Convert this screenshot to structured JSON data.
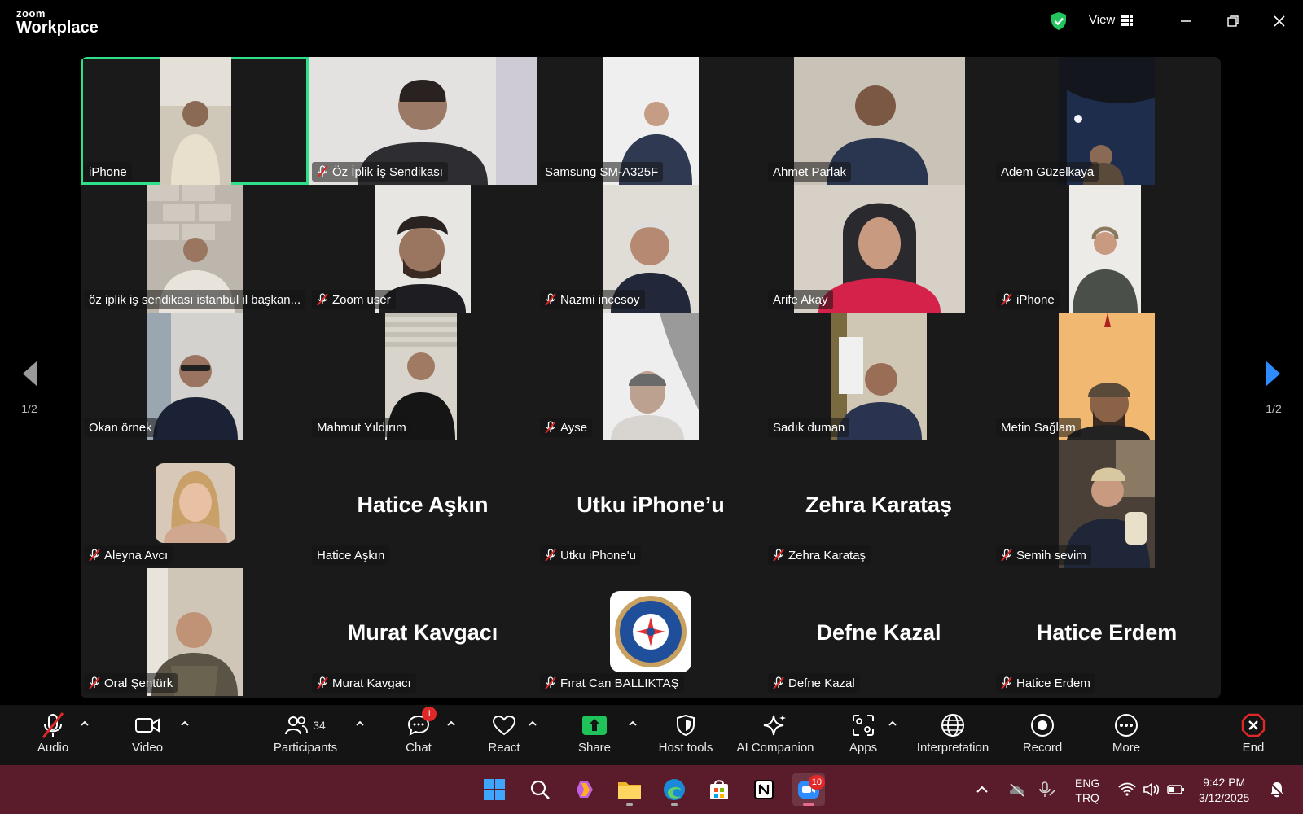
{
  "app": {
    "brand_small": "zoom",
    "brand_large": "Workplace",
    "view_label": "View"
  },
  "pager": {
    "left": "1/2",
    "right": "1/2"
  },
  "participants": [
    {
      "name": "iPhone",
      "muted": false
    },
    {
      "name": "Öz İplik İş Sendikası",
      "muted": true
    },
    {
      "name": "Samsung SM-A325F",
      "muted": false
    },
    {
      "name": "Ahmet Parlak",
      "muted": false
    },
    {
      "name": "Adem Güzelkaya",
      "muted": false
    },
    {
      "name": "öz iplik iş sendikası istanbul il başkan...",
      "muted": false
    },
    {
      "name": "Zoom user",
      "muted": true
    },
    {
      "name": "Nazmi incesoy",
      "muted": true
    },
    {
      "name": "Arife Akay",
      "muted": false
    },
    {
      "name": "iPhone",
      "muted": true
    },
    {
      "name": "Okan örnek",
      "muted": false
    },
    {
      "name": "Mahmut Yıldırım",
      "muted": false
    },
    {
      "name": "Ayse",
      "muted": true
    },
    {
      "name": "Sadık duman",
      "muted": false
    },
    {
      "name": "Metin Sağlam",
      "muted": false
    },
    {
      "name": "Aleyna Avcı",
      "muted": true
    },
    {
      "name": "Hatice Aşkın",
      "muted": false,
      "display": "Hatice Aşkın"
    },
    {
      "name": "Utku iPhone'u",
      "muted": true,
      "display": "Utku iPhone’u"
    },
    {
      "name": "Zehra Karataş",
      "muted": true,
      "display": "Zehra Karataş"
    },
    {
      "name": "Semih sevim",
      "muted": true
    },
    {
      "name": "Oral Şentürk",
      "muted": true
    },
    {
      "name": "Murat Kavgacı",
      "muted": true,
      "display": "Murat Kavgacı"
    },
    {
      "name": "Fırat Can BALLIKTAŞ",
      "muted": true
    },
    {
      "name": "Defne Kazal",
      "muted": true,
      "display": "Defne Kazal"
    },
    {
      "name": "Hatice Erdem",
      "muted": true,
      "display": "Hatice Erdem"
    }
  ],
  "toolbar": {
    "audio": "Audio",
    "video": "Video",
    "participants": "Participants",
    "participants_count": "34",
    "chat": "Chat",
    "chat_badge": "1",
    "react": "React",
    "share": "Share",
    "host_tools": "Host tools",
    "ai_companion": "AI Companion",
    "apps": "Apps",
    "interpretation": "Interpretation",
    "record": "Record",
    "more": "More",
    "end": "End"
  },
  "taskbar": {
    "zoom_badge": "10",
    "lang_line1": "ENG",
    "lang_line2": "TRQ",
    "time": "9:42 PM",
    "date": "3/12/2025"
  },
  "colors": {
    "active_speaker": "#2ee08a",
    "share_green": "#20c25a",
    "end_red": "#e02828",
    "taskbar": "#5a1b2a"
  }
}
